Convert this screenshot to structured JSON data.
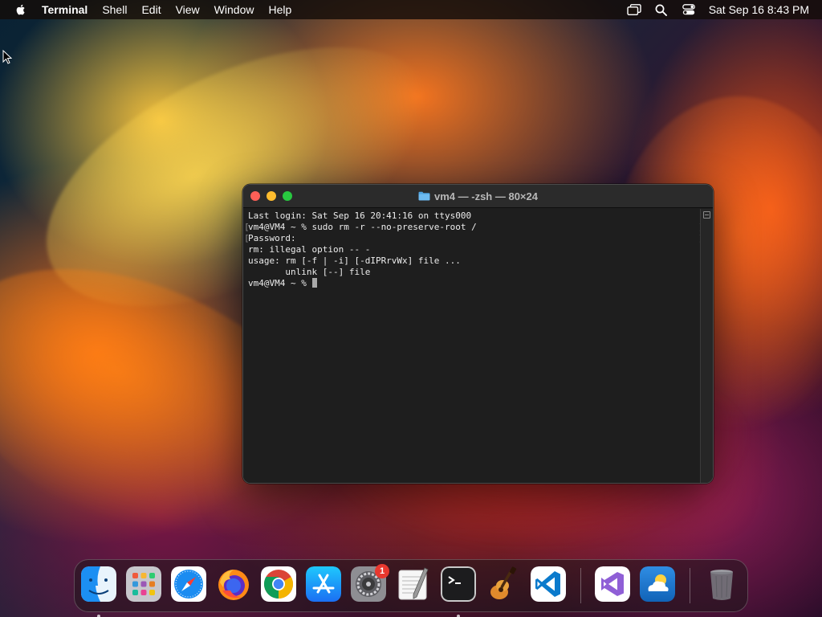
{
  "menubar": {
    "app_name": "Terminal",
    "menus": [
      "Shell",
      "Edit",
      "View",
      "Window",
      "Help"
    ],
    "clock": "Sat Sep 16  8:43 PM",
    "status_icons": [
      "screen-mirroring-icon",
      "search-icon",
      "control-center-icon"
    ]
  },
  "terminal": {
    "title": "vm4 — -zsh — 80×24",
    "lines": [
      "Last login: Sat Sep 16 20:41:16 on ttys000",
      "vm4@VM4 ~ % sudo rm -r --no-preserve-root /",
      "Password:",
      "rm: illegal option -- -",
      "usage: rm [-f | -i] [-dIPRrvWx] file ...",
      "       unlink [--] file",
      "vm4@VM4 ~ % "
    ]
  },
  "dock": {
    "items": [
      {
        "name": "Finder",
        "icon": "finder-icon",
        "running": true
      },
      {
        "name": "Launchpad",
        "icon": "launchpad-icon",
        "running": false
      },
      {
        "name": "Safari",
        "icon": "safari-icon",
        "running": false
      },
      {
        "name": "Firefox",
        "icon": "firefox-icon",
        "running": false
      },
      {
        "name": "Google Chrome",
        "icon": "chrome-icon",
        "running": false
      },
      {
        "name": "App Store",
        "icon": "app-store-icon",
        "running": false
      },
      {
        "name": "System Settings",
        "icon": "system-settings-icon",
        "running": false,
        "badge": "1"
      },
      {
        "name": "TextEdit",
        "icon": "textedit-icon",
        "running": false
      },
      {
        "name": "Terminal",
        "icon": "terminal-icon",
        "running": true
      },
      {
        "name": "GarageBand",
        "icon": "garageband-icon",
        "running": false
      },
      {
        "name": "Visual Studio Code",
        "icon": "vscode-icon",
        "running": false
      },
      {
        "name": "Visual Studio",
        "icon": "visual-studio-icon",
        "running": false
      },
      {
        "name": "Weather",
        "icon": "weather-icon",
        "running": false
      },
      {
        "name": "Trash",
        "icon": "trash-icon",
        "running": false
      }
    ]
  },
  "colors": {
    "terminal_bg": "#1e1e1e",
    "close": "#ff5f57",
    "minimize": "#febc2e",
    "zoom": "#28c840",
    "badge": "#e8382f"
  }
}
